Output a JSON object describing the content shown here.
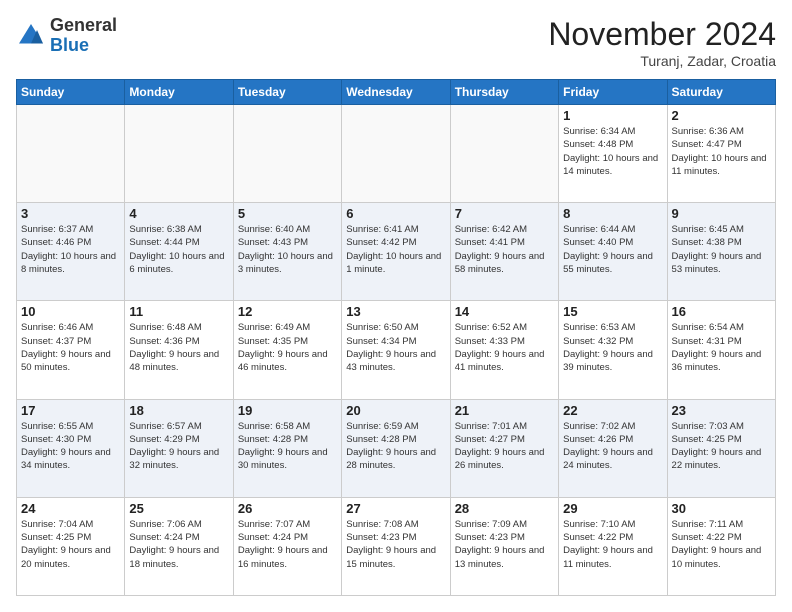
{
  "logo": {
    "general": "General",
    "blue": "Blue"
  },
  "header": {
    "month": "November 2024",
    "location": "Turanj, Zadar, Croatia"
  },
  "days_of_week": [
    "Sunday",
    "Monday",
    "Tuesday",
    "Wednesday",
    "Thursday",
    "Friday",
    "Saturday"
  ],
  "weeks": [
    [
      {
        "day": "",
        "info": ""
      },
      {
        "day": "",
        "info": ""
      },
      {
        "day": "",
        "info": ""
      },
      {
        "day": "",
        "info": ""
      },
      {
        "day": "",
        "info": ""
      },
      {
        "day": "1",
        "info": "Sunrise: 6:34 AM\nSunset: 4:48 PM\nDaylight: 10 hours and 14 minutes."
      },
      {
        "day": "2",
        "info": "Sunrise: 6:36 AM\nSunset: 4:47 PM\nDaylight: 10 hours and 11 minutes."
      }
    ],
    [
      {
        "day": "3",
        "info": "Sunrise: 6:37 AM\nSunset: 4:46 PM\nDaylight: 10 hours and 8 minutes."
      },
      {
        "day": "4",
        "info": "Sunrise: 6:38 AM\nSunset: 4:44 PM\nDaylight: 10 hours and 6 minutes."
      },
      {
        "day": "5",
        "info": "Sunrise: 6:40 AM\nSunset: 4:43 PM\nDaylight: 10 hours and 3 minutes."
      },
      {
        "day": "6",
        "info": "Sunrise: 6:41 AM\nSunset: 4:42 PM\nDaylight: 10 hours and 1 minute."
      },
      {
        "day": "7",
        "info": "Sunrise: 6:42 AM\nSunset: 4:41 PM\nDaylight: 9 hours and 58 minutes."
      },
      {
        "day": "8",
        "info": "Sunrise: 6:44 AM\nSunset: 4:40 PM\nDaylight: 9 hours and 55 minutes."
      },
      {
        "day": "9",
        "info": "Sunrise: 6:45 AM\nSunset: 4:38 PM\nDaylight: 9 hours and 53 minutes."
      }
    ],
    [
      {
        "day": "10",
        "info": "Sunrise: 6:46 AM\nSunset: 4:37 PM\nDaylight: 9 hours and 50 minutes."
      },
      {
        "day": "11",
        "info": "Sunrise: 6:48 AM\nSunset: 4:36 PM\nDaylight: 9 hours and 48 minutes."
      },
      {
        "day": "12",
        "info": "Sunrise: 6:49 AM\nSunset: 4:35 PM\nDaylight: 9 hours and 46 minutes."
      },
      {
        "day": "13",
        "info": "Sunrise: 6:50 AM\nSunset: 4:34 PM\nDaylight: 9 hours and 43 minutes."
      },
      {
        "day": "14",
        "info": "Sunrise: 6:52 AM\nSunset: 4:33 PM\nDaylight: 9 hours and 41 minutes."
      },
      {
        "day": "15",
        "info": "Sunrise: 6:53 AM\nSunset: 4:32 PM\nDaylight: 9 hours and 39 minutes."
      },
      {
        "day": "16",
        "info": "Sunrise: 6:54 AM\nSunset: 4:31 PM\nDaylight: 9 hours and 36 minutes."
      }
    ],
    [
      {
        "day": "17",
        "info": "Sunrise: 6:55 AM\nSunset: 4:30 PM\nDaylight: 9 hours and 34 minutes."
      },
      {
        "day": "18",
        "info": "Sunrise: 6:57 AM\nSunset: 4:29 PM\nDaylight: 9 hours and 32 minutes."
      },
      {
        "day": "19",
        "info": "Sunrise: 6:58 AM\nSunset: 4:28 PM\nDaylight: 9 hours and 30 minutes."
      },
      {
        "day": "20",
        "info": "Sunrise: 6:59 AM\nSunset: 4:28 PM\nDaylight: 9 hours and 28 minutes."
      },
      {
        "day": "21",
        "info": "Sunrise: 7:01 AM\nSunset: 4:27 PM\nDaylight: 9 hours and 26 minutes."
      },
      {
        "day": "22",
        "info": "Sunrise: 7:02 AM\nSunset: 4:26 PM\nDaylight: 9 hours and 24 minutes."
      },
      {
        "day": "23",
        "info": "Sunrise: 7:03 AM\nSunset: 4:25 PM\nDaylight: 9 hours and 22 minutes."
      }
    ],
    [
      {
        "day": "24",
        "info": "Sunrise: 7:04 AM\nSunset: 4:25 PM\nDaylight: 9 hours and 20 minutes."
      },
      {
        "day": "25",
        "info": "Sunrise: 7:06 AM\nSunset: 4:24 PM\nDaylight: 9 hours and 18 minutes."
      },
      {
        "day": "26",
        "info": "Sunrise: 7:07 AM\nSunset: 4:24 PM\nDaylight: 9 hours and 16 minutes."
      },
      {
        "day": "27",
        "info": "Sunrise: 7:08 AM\nSunset: 4:23 PM\nDaylight: 9 hours and 15 minutes."
      },
      {
        "day": "28",
        "info": "Sunrise: 7:09 AM\nSunset: 4:23 PM\nDaylight: 9 hours and 13 minutes."
      },
      {
        "day": "29",
        "info": "Sunrise: 7:10 AM\nSunset: 4:22 PM\nDaylight: 9 hours and 11 minutes."
      },
      {
        "day": "30",
        "info": "Sunrise: 7:11 AM\nSunset: 4:22 PM\nDaylight: 9 hours and 10 minutes."
      }
    ]
  ]
}
